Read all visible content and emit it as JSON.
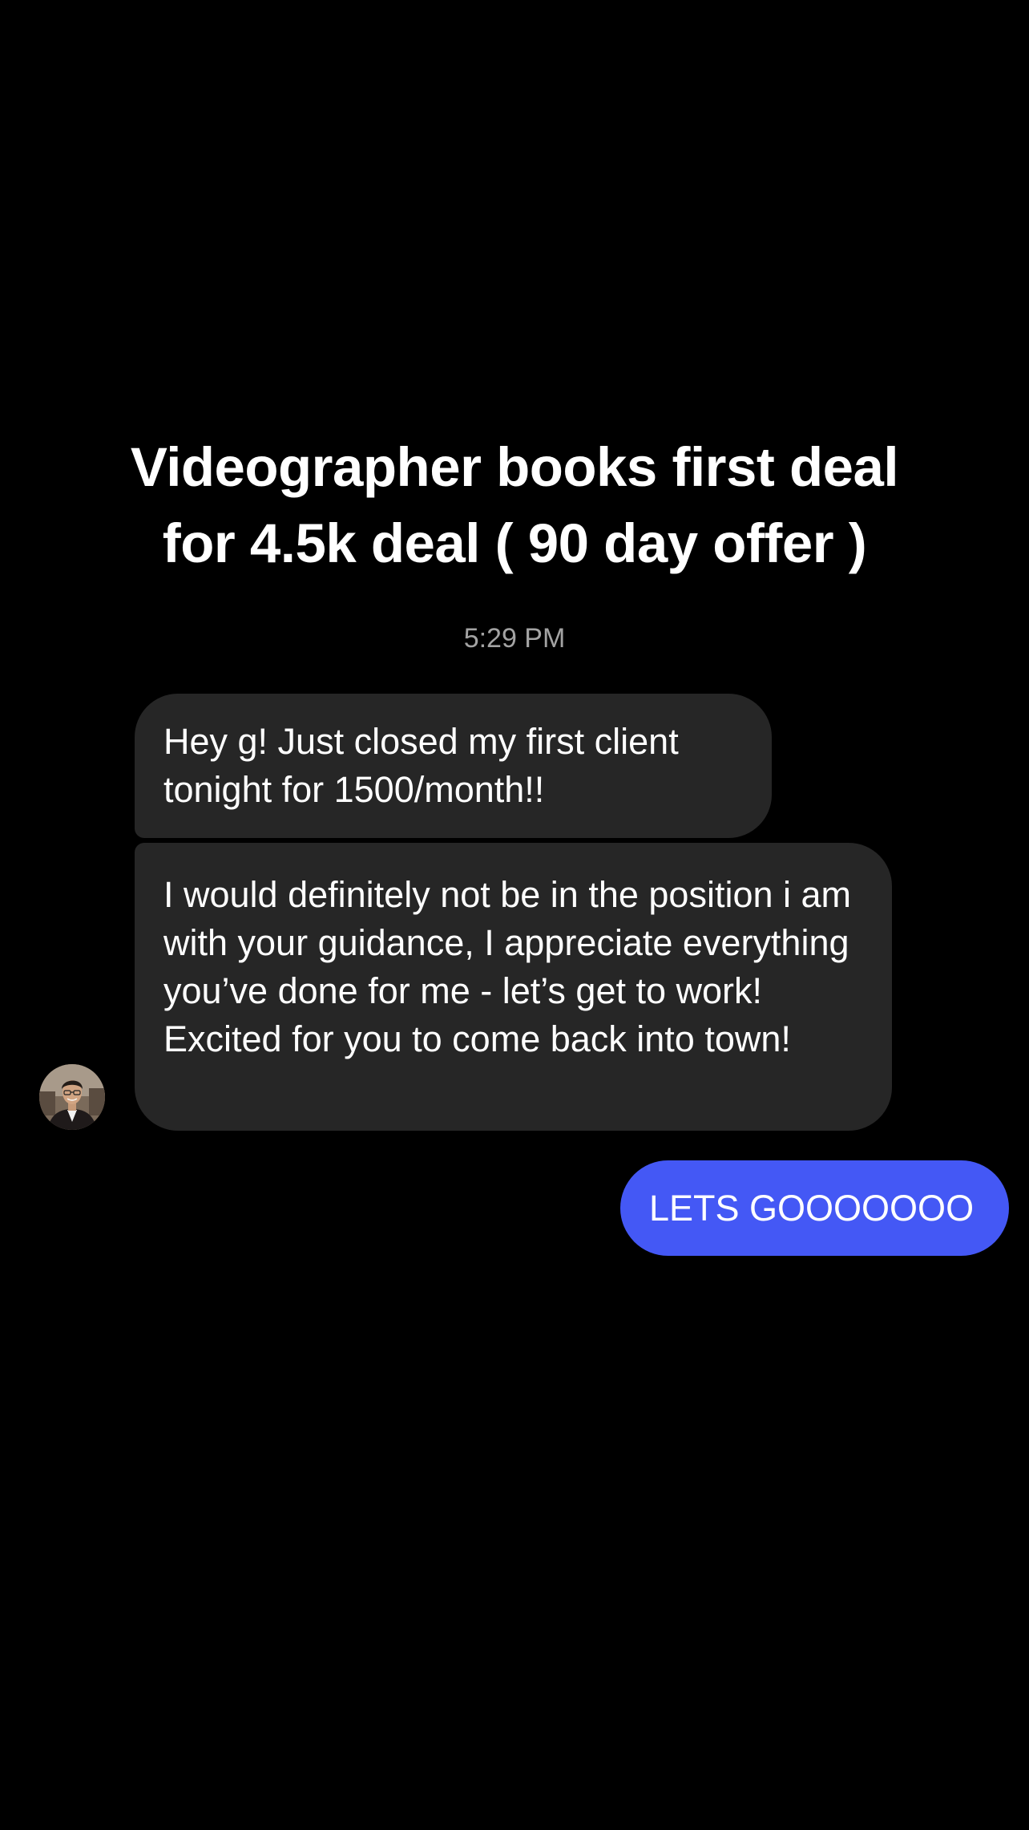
{
  "headline": {
    "line1": "Videographer books first deal",
    "line2": "for 4.5k deal ( 90 day offer )"
  },
  "conversation": {
    "timestamp": "5:29 PM",
    "messages": [
      {
        "direction": "incoming",
        "text": "Hey g! Just closed my first client tonight for 1500/month!!"
      },
      {
        "direction": "incoming",
        "text": "I would definitely not be in the position i am with your guidance, I appreciate everything you’ve done for me - let’s get to work! Excited for you to come back into town!"
      },
      {
        "direction": "outgoing",
        "text": "LETS GOOOOOOO"
      }
    ],
    "sender_avatar_icon": "avatar-photo"
  },
  "colors": {
    "background": "#000000",
    "incoming_bubble": "#262626",
    "outgoing_bubble": "#4458f5",
    "timestamp": "#a3a3a3"
  }
}
